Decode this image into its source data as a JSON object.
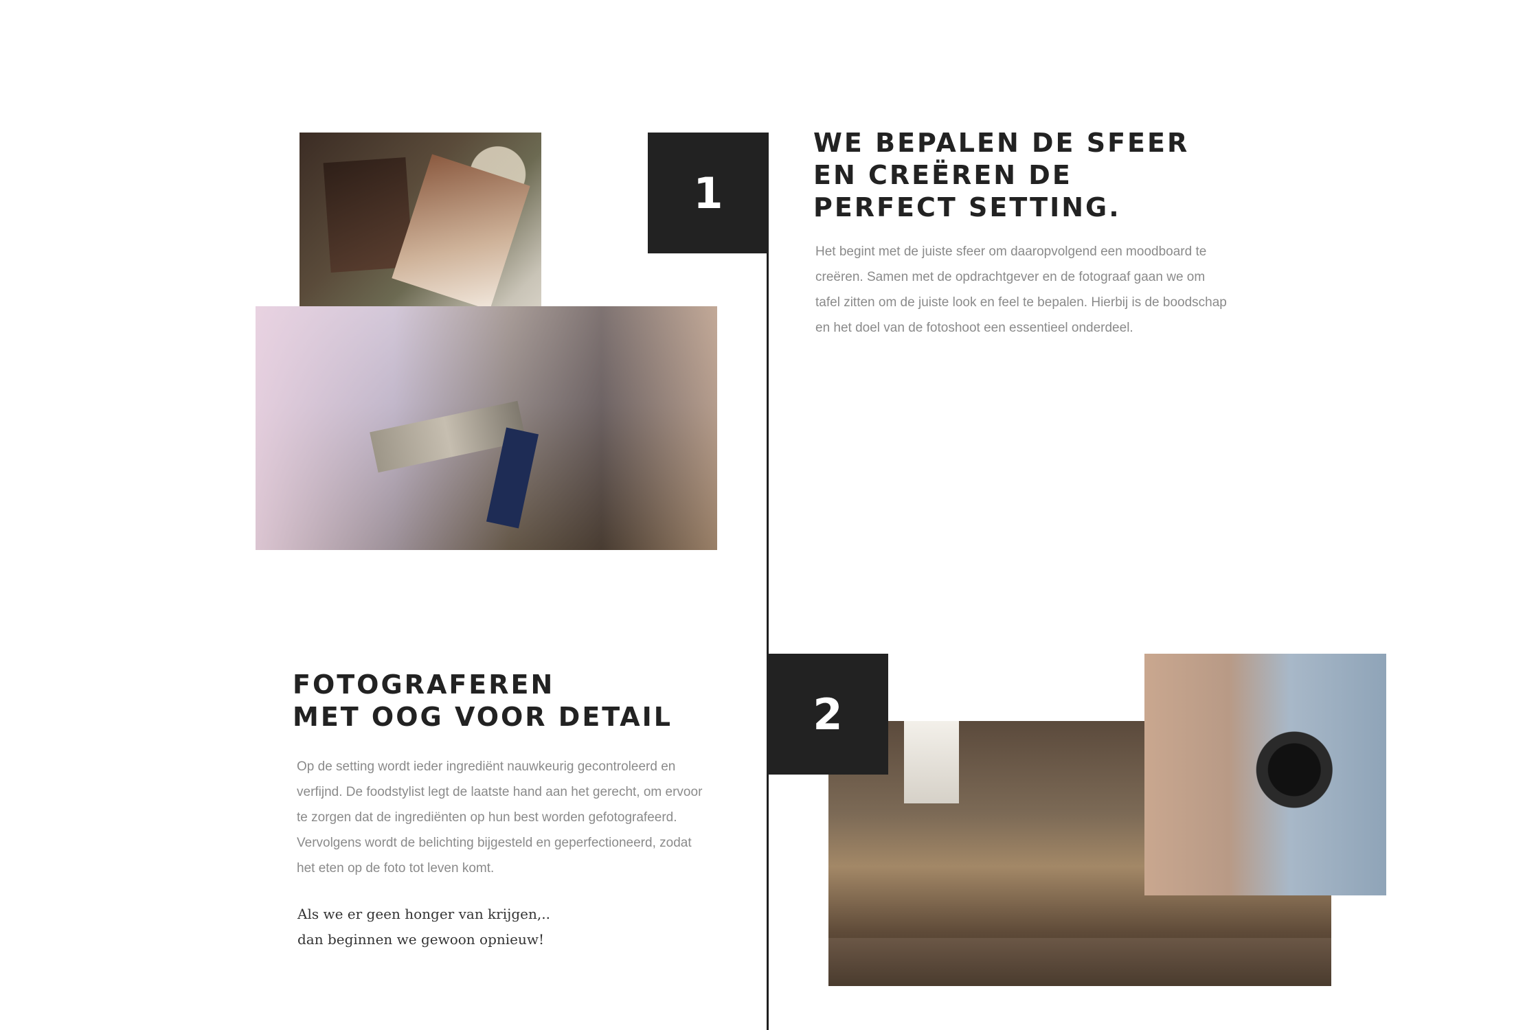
{
  "steps": [
    {
      "number": "1",
      "heading_lines": [
        "WE BEPALEN DE SFEER",
        "EN CREËREN DE",
        "PERFECT SETTING."
      ],
      "body_lines": [
        "Het begint met de juiste sfeer om daaropvolgend een moodboard te",
        "creëren. Samen met de opdrachtgever en de fotograaf gaan we om",
        "tafel zitten om de juiste look en feel te bepalen. Hierbij is de boodschap",
        "en het doel van de fotoshoot een essentieel onderdeel."
      ]
    },
    {
      "number": "2",
      "heading_lines": [
        "FOTOGRAFEREN",
        "MET OOG VOOR DETAIL"
      ],
      "body_lines": [
        "Op de setting wordt ieder ingrediënt nauwkeurig gecontroleerd en",
        "verfijnd. De foodstylist legt de laatste hand aan het gerecht, om ervoor",
        "te zorgen dat de ingrediënten op hun best worden gefotografeerd.",
        "Vervolgens wordt de belichting bijgesteld en geperfectioneerd, zodat",
        "het eten op de foto tot leven komt."
      ],
      "tagline_lines": [
        "Als we er geen honger van krijgen,..",
        "dan beginnen we gewoon opnieuw!"
      ]
    }
  ],
  "colors": {
    "step_box": "#222222",
    "heading": "#222222",
    "body_text": "#8a8a8a",
    "line": "#1f1f1f"
  }
}
